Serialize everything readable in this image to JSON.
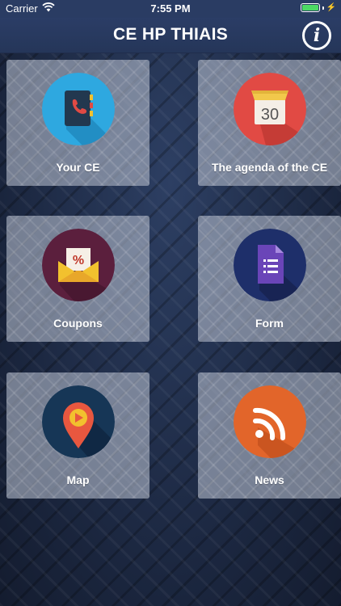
{
  "status_bar": {
    "carrier": "Carrier",
    "time": "7:55 PM",
    "icons": [
      "wifi-icon",
      "battery-icon",
      "charging-bolt-icon"
    ]
  },
  "nav": {
    "title": "CE HP THIAIS",
    "info_icon_glyph": "i"
  },
  "tiles": [
    {
      "label": "Your CE",
      "icon": "phonebook-icon",
      "color": "#2ea8e0"
    },
    {
      "label": "The agenda of the CE",
      "icon": "calendar-icon",
      "color": "#e14a44",
      "calendar_day": "30"
    },
    {
      "label": "Coupons",
      "icon": "coupon-envelope-icon",
      "color": "#5b1f3d",
      "coupon_symbol": "%"
    },
    {
      "label": "Form",
      "icon": "form-document-icon",
      "color": "#1e2f6a"
    },
    {
      "label": "Map",
      "icon": "map-pin-icon",
      "color": "#163656"
    },
    {
      "label": "News",
      "icon": "rss-icon",
      "color": "#e2652a"
    }
  ]
}
